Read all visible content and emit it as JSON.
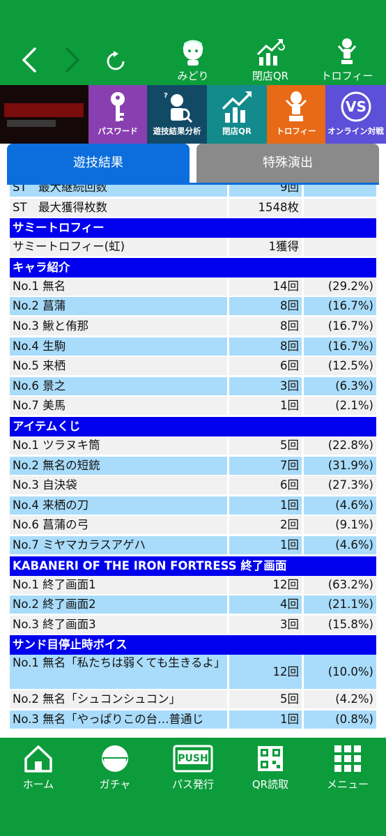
{
  "topbar": {
    "links": [
      {
        "label": "みどり",
        "icon": "character-icon"
      },
      {
        "label": "閉店QR",
        "icon": "chart-up-icon"
      },
      {
        "label": "トロフィー",
        "icon": "trophy-figure-icon"
      }
    ]
  },
  "banners": {
    "logo_text": "甲鉄城のカバネリ 海門決戦",
    "items": [
      {
        "label": "パスワード",
        "icon": "key-icon"
      },
      {
        "label": "遊技結果分析",
        "icon": "analysis-icon"
      },
      {
        "label": "閉店QR",
        "icon": "chart-up-icon"
      },
      {
        "label": "トロフィー",
        "icon": "trophy-figure-icon"
      },
      {
        "label": "オンライン対戦",
        "icon": "online-vs-icon"
      }
    ]
  },
  "tabs": {
    "active": "遊技結果",
    "inactive": "特殊演出"
  },
  "partial_row": "ST 最大継続回数",
  "rows_top": [
    {
      "name": "ST　最大継続回数",
      "count": "9回",
      "pct": ""
    },
    {
      "name": "ST　最大獲得枚数",
      "count": "1548枚",
      "pct": ""
    }
  ],
  "sections": [
    {
      "title": "サミートロフィー",
      "rows": [
        {
          "name": "サミートロフィー(虹)",
          "count": "1獲得",
          "pct": ""
        }
      ]
    },
    {
      "title": "キャラ紹介",
      "rows": [
        {
          "name": "No.1 無名",
          "count": "14回",
          "pct": "(29.2%)"
        },
        {
          "name": "No.2 菖蒲",
          "count": "8回",
          "pct": "(16.7%)"
        },
        {
          "name": "No.3 鰍と侑那",
          "count": "8回",
          "pct": "(16.7%)"
        },
        {
          "name": "No.4 生駒",
          "count": "8回",
          "pct": "(16.7%)"
        },
        {
          "name": "No.5 来栖",
          "count": "6回",
          "pct": "(12.5%)"
        },
        {
          "name": "No.6 景之",
          "count": "3回",
          "pct": "(6.3%)"
        },
        {
          "name": "No.7 美馬",
          "count": "1回",
          "pct": "(2.1%)"
        }
      ]
    },
    {
      "title": "アイテムくじ",
      "rows": [
        {
          "name": "No.1 ツラヌキ筒",
          "count": "5回",
          "pct": "(22.8%)"
        },
        {
          "name": "No.2 無名の短銃",
          "count": "7回",
          "pct": "(31.9%)"
        },
        {
          "name": "No.3 自決袋",
          "count": "6回",
          "pct": "(27.3%)"
        },
        {
          "name": "No.4 来栖の刀",
          "count": "1回",
          "pct": "(4.6%)"
        },
        {
          "name": "No.6 菖蒲の弓",
          "count": "2回",
          "pct": "(9.1%)"
        },
        {
          "name": "No.7 ミヤマカラスアゲハ",
          "count": "1回",
          "pct": "(4.6%)"
        }
      ]
    },
    {
      "title": "KABANERI OF THE IRON FORTRESS 終了画面",
      "rows": [
        {
          "name": "No.1 終了画面1",
          "count": "12回",
          "pct": "(63.2%)"
        },
        {
          "name": "No.2 終了画面2",
          "count": "4回",
          "pct": "(21.1%)"
        },
        {
          "name": "No.3 終了画面3",
          "count": "3回",
          "pct": "(15.8%)"
        }
      ]
    },
    {
      "title": "サンド目停止時ボイス",
      "rows": [
        {
          "name": "No.1 無名「私たちは弱くても生きるよ」",
          "count": "12回",
          "pct": "(10.0%)",
          "tall": true
        },
        {
          "name": "No.2 無名「シュコンシュコン」",
          "count": "5回",
          "pct": "(4.2%)"
        },
        {
          "name": "No.3 無名「やっぱりこの台…普通じ",
          "count": "1回",
          "pct": "(0.8%)"
        }
      ]
    }
  ],
  "bottom_nav": [
    {
      "label": "ホーム",
      "icon": "home-icon"
    },
    {
      "label": "ガチャ",
      "icon": "gacha-icon"
    },
    {
      "label": "パス発行",
      "icon": "push-icon"
    },
    {
      "label": "QR読取",
      "icon": "qr-code-icon"
    },
    {
      "label": "メニュー",
      "icon": "menu-grid-icon"
    }
  ],
  "push_text": "PUSH",
  "colors": {
    "app_green": "#0d9c3c",
    "section_blue": "#0000ee",
    "row_blue": "#a9dcfa",
    "row_gray": "#f1f1f1",
    "tab_active": "#0b6edc",
    "tab_inactive": "#8a8a8a"
  }
}
